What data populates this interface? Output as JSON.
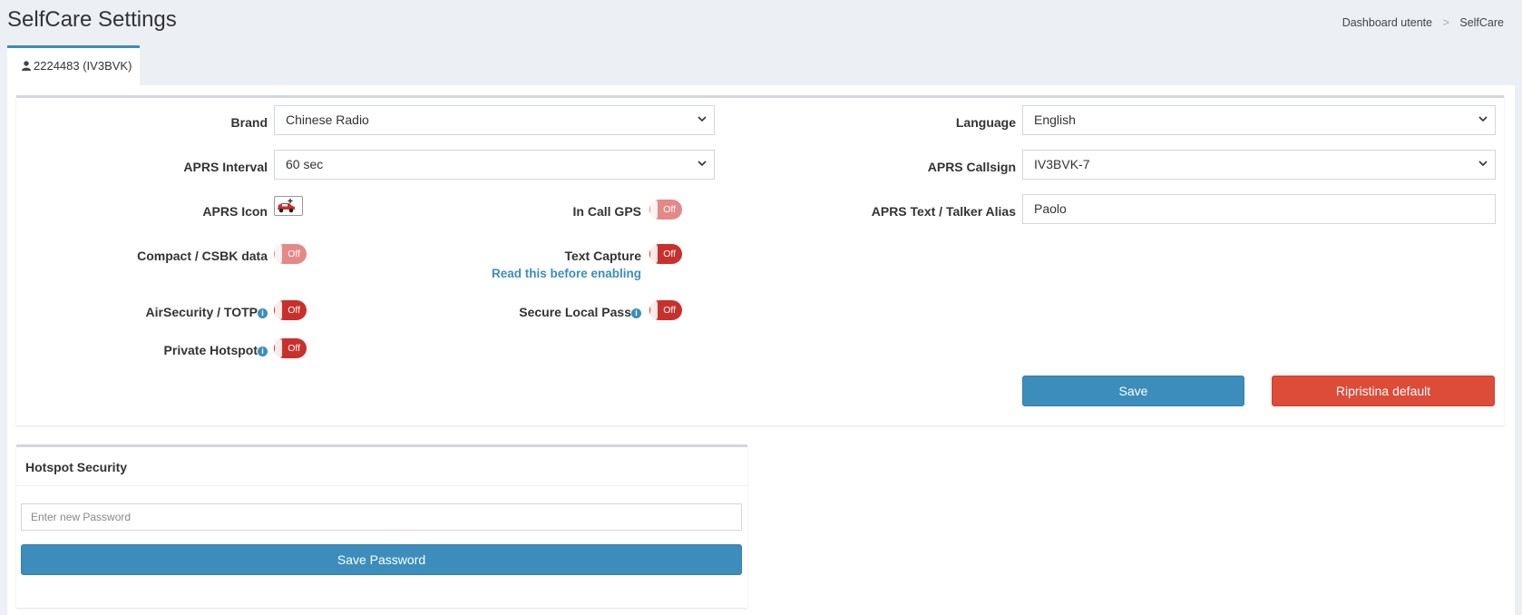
{
  "header": {
    "title": "SelfCare Settings",
    "breadcrumb": [
      {
        "label": "Dashboard utente"
      },
      {
        "label": "SelfCare"
      }
    ],
    "breadcrumb_sep": ">"
  },
  "tab": {
    "label": "2224483 (IV3BVK)",
    "icon": "user-icon"
  },
  "settings": {
    "brand": {
      "label": "Brand",
      "value": "Chinese Radio"
    },
    "language": {
      "label": "Language",
      "value": "English"
    },
    "aprs_interval": {
      "label": "APRS Interval",
      "value": "60 sec"
    },
    "aprs_callsign": {
      "label": "APRS Callsign",
      "value": "IV3BVK-7"
    },
    "aprs_icon": {
      "label": "APRS Icon",
      "icon": "car-icon"
    },
    "in_call_gps": {
      "label": "In Call GPS",
      "state": "Off",
      "enabled": false
    },
    "aprs_text": {
      "label": "APRS Text / Talker Alias",
      "value": "Paolo"
    },
    "compact_csbk": {
      "label": "Compact / CSBK data",
      "state": "Off",
      "enabled": false
    },
    "text_capture": {
      "label": "Text Capture",
      "state": "Off",
      "link": "Read this before enabling"
    },
    "air_security": {
      "label": "AirSecurity / TOTP",
      "state": "Off",
      "info": "i"
    },
    "secure_local_pass": {
      "label": "Secure Local Pass",
      "state": "Off",
      "info": "i"
    },
    "private_hotspot": {
      "label": "Private Hotspot",
      "state": "Off",
      "info": "i"
    }
  },
  "actions": {
    "save": "Save",
    "reset": "Ripristina default"
  },
  "hotspot_security": {
    "title": "Hotspot Security",
    "password_placeholder": "Enter new Password",
    "save_password": "Save Password"
  },
  "colors": {
    "primary": "#3c8dbc",
    "danger": "#dd4b39",
    "toggle_off": "#c9302c",
    "background": "#ecf0f5"
  }
}
